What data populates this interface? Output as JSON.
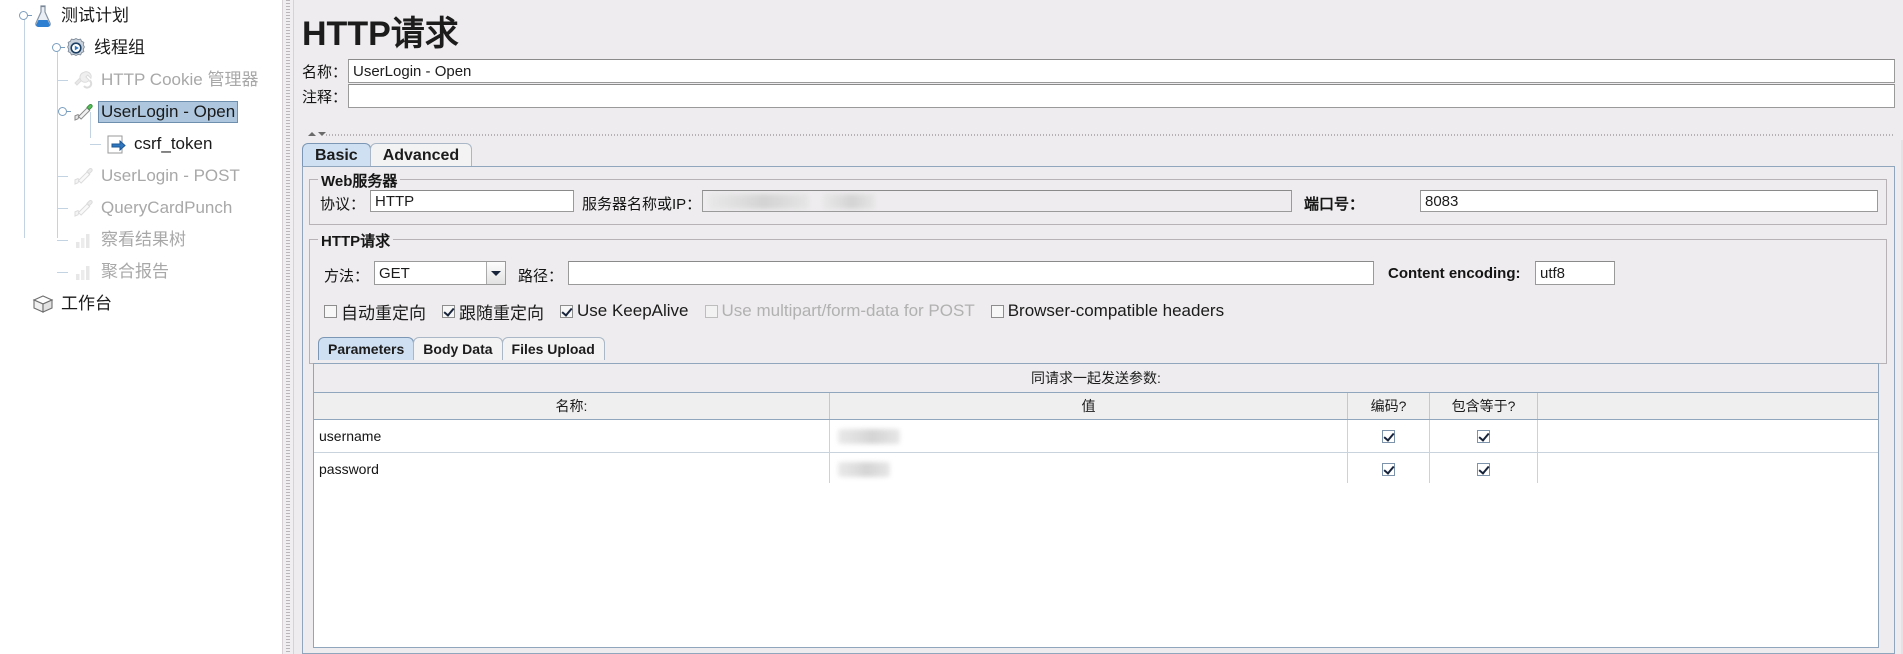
{
  "tree": {
    "nodes": [
      {
        "label": "测试计划",
        "icon": "test-plan-icon",
        "depth": 0,
        "state": "normal",
        "expander": true
      },
      {
        "label": "线程组",
        "icon": "thread-group-icon",
        "depth": 1,
        "state": "normal",
        "expander": true
      },
      {
        "label": "HTTP Cookie 管理器",
        "icon": "cookie-manager-icon",
        "depth": 2,
        "state": "disabled",
        "expander": false
      },
      {
        "label": "UserLogin - Open",
        "icon": "http-sampler-icon",
        "depth": 2,
        "state": "selected",
        "expander": true
      },
      {
        "label": "csrf_token",
        "icon": "extractor-icon",
        "depth": 3,
        "state": "normal",
        "expander": false
      },
      {
        "label": "UserLogin - POST",
        "icon": "http-sampler-icon",
        "depth": 2,
        "state": "disabled",
        "expander": false
      },
      {
        "label": "QueryCardPunch",
        "icon": "http-sampler-icon",
        "depth": 2,
        "state": "disabled",
        "expander": false
      },
      {
        "label": "察看结果树",
        "icon": "results-tree-icon",
        "depth": 2,
        "state": "disabled",
        "expander": false
      },
      {
        "label": "聚合报告",
        "icon": "aggregate-report-icon",
        "depth": 2,
        "state": "disabled",
        "expander": false
      },
      {
        "label": "工作台",
        "icon": "workbench-icon",
        "depth": 0,
        "state": "normal",
        "expander": false
      }
    ]
  },
  "panel": {
    "title": "HTTP请求",
    "name_label": "名称：",
    "name_value": "UserLogin - Open",
    "comment_label": "注释：",
    "comment_value": "",
    "tabs": [
      {
        "label": "Basic",
        "selected": true
      },
      {
        "label": "Advanced",
        "selected": false
      }
    ]
  },
  "web_server": {
    "group_title": "Web服务器",
    "protocol_label": "协议：",
    "protocol_value": "HTTP",
    "server_label": "服务器名称或IP：",
    "server_value": "",
    "server_redacted": true,
    "port_label": "端口号：",
    "port_value": "8083"
  },
  "http_request": {
    "group_title": "HTTP请求",
    "method_label": "方法：",
    "method_value": "GET",
    "path_label": "路径：",
    "path_value": "",
    "content_encoding_label": "Content encoding:",
    "content_encoding_value": "utf8",
    "checkboxes": [
      {
        "label": "自动重定向",
        "checked": false,
        "disabled": false
      },
      {
        "label": "跟随重定向",
        "checked": true,
        "disabled": false
      },
      {
        "label": "Use KeepAlive",
        "checked": true,
        "disabled": false
      },
      {
        "label": "Use multipart/form-data for POST",
        "checked": false,
        "disabled": true
      },
      {
        "label": "Browser-compatible headers",
        "checked": false,
        "disabled": false
      }
    ]
  },
  "param_tabs": [
    {
      "label": "Parameters",
      "selected": true
    },
    {
      "label": "Body Data",
      "selected": false
    },
    {
      "label": "Files Upload",
      "selected": false
    }
  ],
  "param_table": {
    "caption": "同请求一起发送参数:",
    "columns": [
      "名称:",
      "值",
      "编码?",
      "包含等于?"
    ],
    "rows": [
      {
        "name": "username",
        "value": "",
        "value_redacted": true,
        "encode": true,
        "include_equals": true
      },
      {
        "name": "password",
        "value": "",
        "value_redacted": true,
        "encode": true,
        "include_equals": true
      }
    ]
  },
  "colors": {
    "panel_bg": "#eeecee",
    "tab_selected": "#cfe0f2",
    "tree_selection": "#aec7de",
    "border": "#8fa6bd"
  }
}
